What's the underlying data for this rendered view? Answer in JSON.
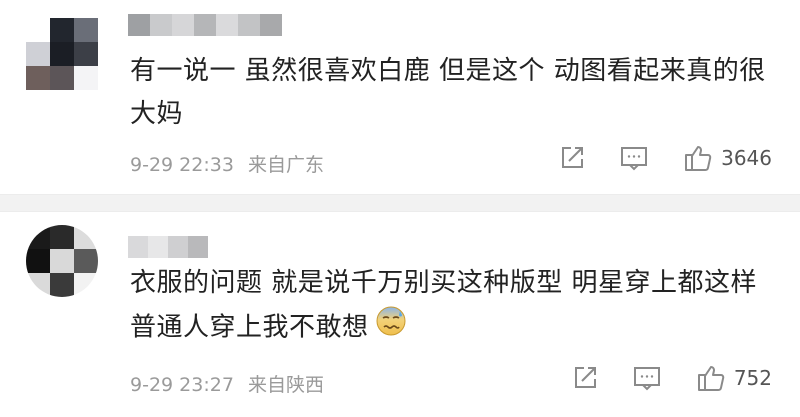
{
  "comments": [
    {
      "text": "有一说一 虽然很喜欢白鹿 但是这个 动图看起来真的很大妈",
      "date": "9-29 22:33",
      "location": "来自广东",
      "likes": "3646"
    },
    {
      "text": "衣服的问题 就是说千万别买这种版型 明星穿上都这样 普通人穿上我不敢想",
      "date": "9-29 23:27",
      "location": "来自陕西",
      "likes": "752",
      "emoji_icon": "cold-sweat-face-icon"
    }
  ],
  "colors": {
    "text": "#222222",
    "meta": "#9a9a9a",
    "divider": "#f2f2f2",
    "icon": "#8a8a8a"
  }
}
